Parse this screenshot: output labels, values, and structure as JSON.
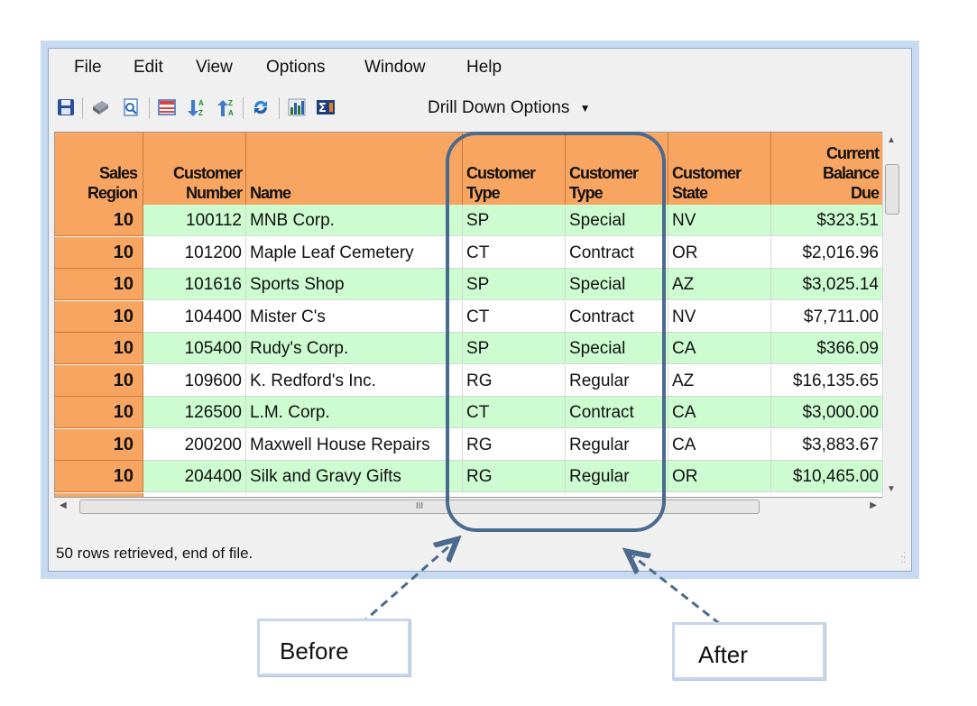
{
  "menu": [
    "File",
    "Edit",
    "View",
    "Options",
    "Window",
    "Help"
  ],
  "toolbar": {
    "drill_label": "Drill Down Options",
    "icons": [
      "save-icon",
      "print-icon",
      "print-preview-icon",
      "filter-icon",
      "sort-ascending-icon",
      "sort-descending-icon",
      "refresh-icon",
      "chart-icon",
      "sum-icon"
    ]
  },
  "columns": {
    "region": [
      "Sales",
      "Region"
    ],
    "custnum": [
      "Customer",
      "Number"
    ],
    "name": [
      "",
      "Name"
    ],
    "type1": [
      "Customer",
      "Type"
    ],
    "type2": [
      "Customer",
      "Type"
    ],
    "state": [
      "Customer",
      "State"
    ],
    "balance": [
      "Current",
      "Balance",
      "Due"
    ]
  },
  "rows": [
    {
      "region": "10",
      "num": "100112",
      "name": "MNB Corp.",
      "code": "SP",
      "type": "Special",
      "state": "NV",
      "bal": "$323.51"
    },
    {
      "region": "10",
      "num": "101200",
      "name": "Maple Leaf Cemetery",
      "code": "CT",
      "type": "Contract",
      "state": "OR",
      "bal": "$2,016.96"
    },
    {
      "region": "10",
      "num": "101616",
      "name": "Sports Shop",
      "code": "SP",
      "type": "Special",
      "state": "AZ",
      "bal": "$3,025.14"
    },
    {
      "region": "10",
      "num": "104400",
      "name": "Mister C's",
      "code": "CT",
      "type": "Contract",
      "state": "NV",
      "bal": "$7,711.00"
    },
    {
      "region": "10",
      "num": "105400",
      "name": "Rudy's Corp.",
      "code": "SP",
      "type": "Special",
      "state": "CA",
      "bal": "$366.09"
    },
    {
      "region": "10",
      "num": "109600",
      "name": "K. Redford's Inc.",
      "code": "RG",
      "type": "Regular",
      "state": "AZ",
      "bal": "$16,135.65"
    },
    {
      "region": "10",
      "num": "126500",
      "name": "L.M. Corp.",
      "code": "CT",
      "type": "Contract",
      "state": "CA",
      "bal": "$3,000.00"
    },
    {
      "region": "10",
      "num": "200200",
      "name": "Maxwell House Repairs",
      "code": "RG",
      "type": "Regular",
      "state": "CA",
      "bal": "$3,883.67"
    },
    {
      "region": "10",
      "num": "204400",
      "name": "Silk and Gravy Gifts",
      "code": "RG",
      "type": "Regular",
      "state": "OR",
      "bal": "$10,465.00"
    }
  ],
  "scroll_grip": "III",
  "status_text": "50 rows retrieved, end of file.",
  "callouts": {
    "before": "Before",
    "after": "After"
  },
  "colors": {
    "header": "#f8a561",
    "row_green": "#cdfcd0",
    "highlight": "#4a6a8e"
  }
}
